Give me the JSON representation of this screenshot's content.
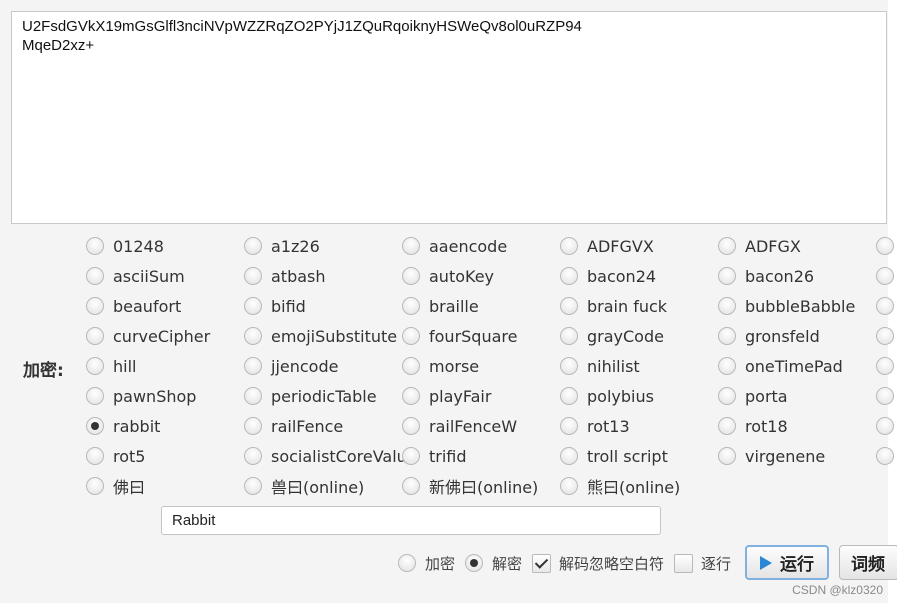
{
  "output_text": "U2FsdGVkX19mGsGlfl3nciNVpWZZRqZO2PYjJ1ZQuRqoiknyHSWeQv8ol0uRZP94\nMqeD2xz+",
  "encrypt_label": "加密:",
  "algorithms": [
    [
      "01248",
      "a1z26",
      "aaencode",
      "ADFGVX",
      "ADFGX",
      ""
    ],
    [
      "asciiSum",
      "atbash",
      "autoKey",
      "bacon24",
      "bacon26",
      ""
    ],
    [
      "beaufort",
      "bifid",
      "braille",
      "brain fuck",
      "bubbleBabble",
      ""
    ],
    [
      "curveCipher",
      "emojiSubstitute",
      "fourSquare",
      "grayCode",
      "gronsfeld",
      ""
    ],
    [
      "hill",
      "jjencode",
      "morse",
      "nihilist",
      "oneTimePad",
      ""
    ],
    [
      "pawnShop",
      "periodicTable",
      "playFair",
      "polybius",
      "porta",
      ""
    ],
    [
      "rabbit",
      "railFence",
      "railFenceW",
      "rot13",
      "rot18",
      ""
    ],
    [
      "rot5",
      "socialistCoreValue",
      "trifid",
      "troll script",
      "virgenene",
      ""
    ],
    [
      "佛曰",
      "兽曰(online)",
      "新佛曰(online)",
      "熊曰(online)"
    ]
  ],
  "selected_algorithm": "rabbit",
  "key_value": "Rabbit",
  "bottom": {
    "encrypt_label": "加密",
    "decrypt_label": "解密",
    "mode_selected": "decrypt",
    "ignore_ws_label": "解码忽略空白符",
    "ignore_ws_checked": true,
    "line_by_line_label": "逐行",
    "line_by_line_checked": false,
    "run_label": "运行",
    "freq_label": "词频"
  },
  "watermark": "CSDN @klz0320",
  "colors": {
    "accent": "#2c86d6",
    "focus_border": "#7fb2e0",
    "panel_bg": "#f4f4f4"
  },
  "icons": {
    "run": "play-icon"
  }
}
